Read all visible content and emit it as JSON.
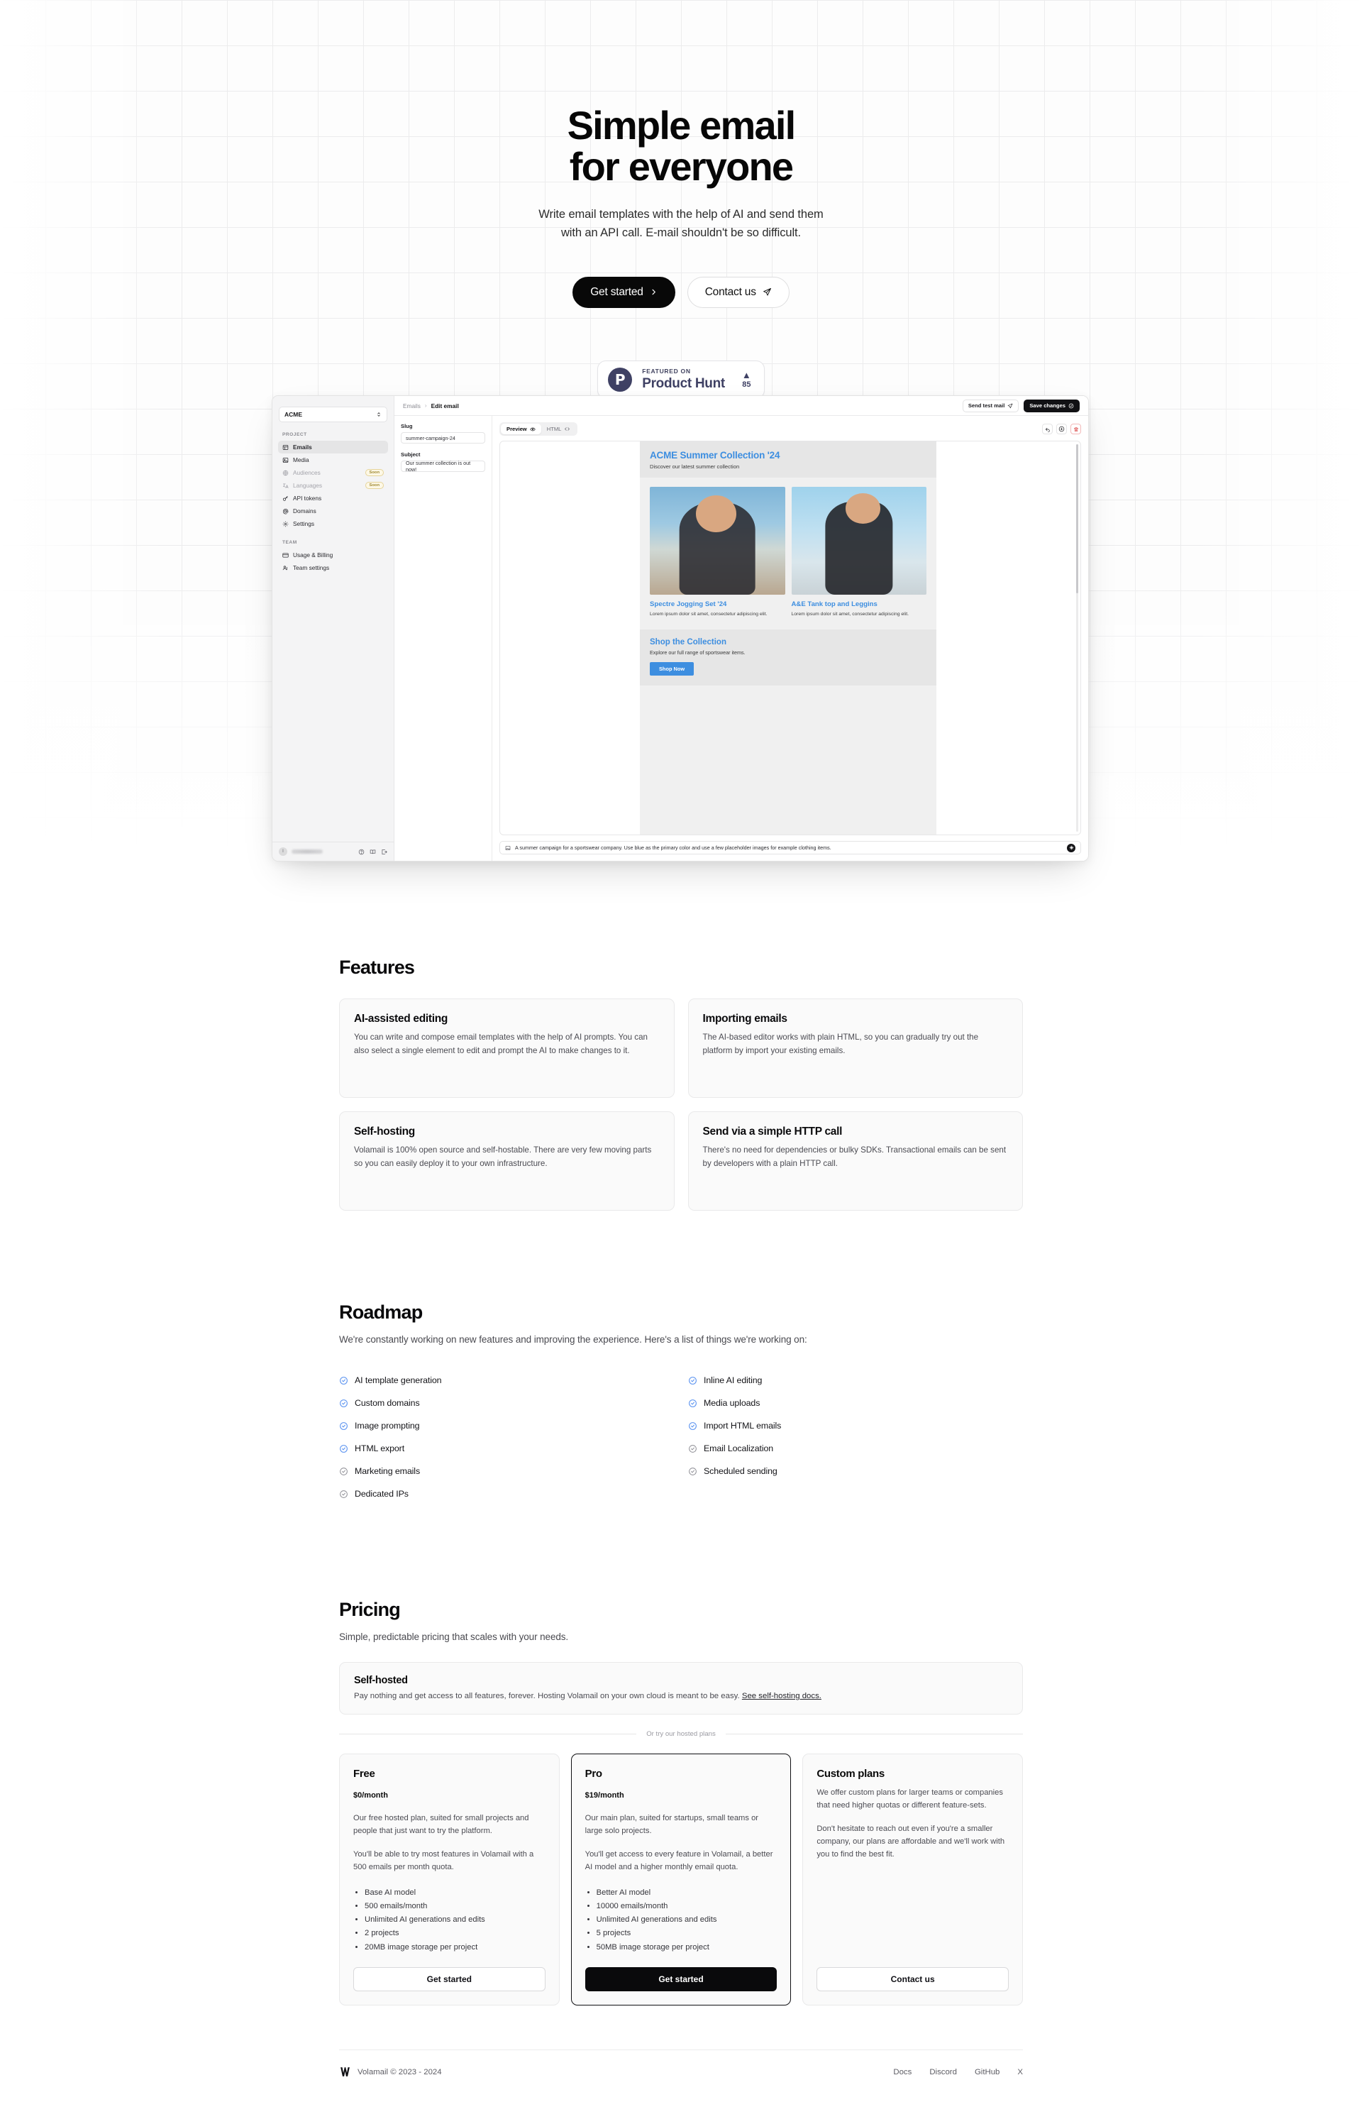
{
  "hero": {
    "title_line1": "Simple email",
    "title_line2": "for everyone",
    "subtitle_line1": "Write email templates with the help of AI and send them",
    "subtitle_line2": "with an API call. E-mail shouldn't be so difficult.",
    "cta_primary": "Get started",
    "cta_primary_icon": "chevron-right-icon",
    "cta_secondary": "Contact us",
    "cta_secondary_icon": "paper-plane-icon"
  },
  "product_hunt": {
    "logo_letter": "P",
    "kicker": "FEATURED ON",
    "name": "Product Hunt",
    "upvote_icon": "▲",
    "votes": "85"
  },
  "app": {
    "project_switcher": "ACME",
    "project_switcher_icon": "chevron-updown-icon",
    "groups": [
      {
        "label": "PROJECT",
        "items": [
          {
            "label": "Emails",
            "icon": "table-icon",
            "active": true,
            "badge": ""
          },
          {
            "label": "Media",
            "icon": "image-icon",
            "active": false,
            "badge": ""
          },
          {
            "label": "Audiences",
            "icon": "globe-icon",
            "active": false,
            "badge": "Soon"
          },
          {
            "label": "Languages",
            "icon": "translate-icon",
            "active": false,
            "badge": "Soon"
          },
          {
            "label": "API tokens",
            "icon": "key-icon",
            "active": false,
            "badge": ""
          },
          {
            "label": "Domains",
            "icon": "at-icon",
            "active": false,
            "badge": ""
          },
          {
            "label": "Settings",
            "icon": "gear-icon",
            "active": false,
            "badge": ""
          }
        ]
      },
      {
        "label": "TEAM",
        "items": [
          {
            "label": "Usage & Billing",
            "icon": "card-icon",
            "active": false,
            "badge": ""
          },
          {
            "label": "Team settings",
            "icon": "users-icon",
            "active": false,
            "badge": ""
          }
        ]
      }
    ],
    "sidebar_footer": {
      "avatar_letter": "I",
      "icons": [
        "help-icon",
        "docs-icon",
        "logout-icon"
      ]
    },
    "breadcrumb_root": "Emails",
    "breadcrumb_sep": "›",
    "breadcrumb_current": "Edit email",
    "send_test_label": "Send test mail",
    "send_test_icon": "paper-plane-icon",
    "save_label": "Save changes",
    "save_icon": "check-circle-icon",
    "slug_label": "Slug",
    "slug_value": "summer-campaign-24",
    "subject_label": "Subject",
    "subject_value": "Our summer collection is out now!",
    "tab_preview": "Preview",
    "tab_preview_icon": "eye-icon",
    "tab_html": "HTML",
    "tab_html_icon": "code-icon",
    "tool_undo_icon": "undo-icon",
    "tool_save_icon": "cloud-save-icon",
    "tool_delete_icon": "trash-icon",
    "prompt_icon": "image-icon",
    "prompt_text": "A summer campaign for a sportswear company. Use blue as the primary color and use a few placeholder images for example clothing items.",
    "prompt_send_icon": "sparkle-icon",
    "email": {
      "heading": "ACME Summer Collection '24",
      "subheading": "Discover our latest summer collection",
      "products": [
        {
          "title": "Spectre Jogging Set '24",
          "desc": "Lorem ipsum dolor sit amet, consectetur adipiscing elit."
        },
        {
          "title": "A&E Tank top and Leggins",
          "desc": "Lorem ipsum dolor sit amet, consectetur adipiscing elit."
        }
      ],
      "footer_title": "Shop the Collection",
      "footer_sub": "Explore our full range of sportswear items.",
      "footer_button": "Shop Now"
    }
  },
  "features": {
    "title": "Features",
    "cards": [
      {
        "title": "AI-assisted editing",
        "body": "You can write and compose email templates with the help of AI prompts. You can also select a single element to edit and prompt the AI to make changes to it."
      },
      {
        "title": "Importing emails",
        "body": "The AI-based editor works with plain HTML, so you can gradually try out the platform by import your existing emails."
      },
      {
        "title": "Self-hosting",
        "body": "Volamail is 100% open source and self-hostable. There are very few moving parts so you can easily deploy it to your own infrastructure."
      },
      {
        "title": "Send via a simple HTTP call",
        "body": "There's no need for dependencies or bulky SDKs. Transactional emails can be sent by developers with a plain HTTP call."
      }
    ]
  },
  "roadmap": {
    "title": "Roadmap",
    "subtitle": "We're constantly working on new features and improving the experience. Here's a list of things we're working on:",
    "done_color": "#5b93f0",
    "pending_color": "#8d8d94",
    "left_items": [
      {
        "label": "AI template generation",
        "done": true
      },
      {
        "label": "Custom domains",
        "done": true
      },
      {
        "label": "Image prompting",
        "done": true
      },
      {
        "label": "HTML export",
        "done": true
      },
      {
        "label": "Marketing emails",
        "done": false
      },
      {
        "label": "Dedicated IPs",
        "done": false
      }
    ],
    "right_items": [
      {
        "label": "Inline AI editing",
        "done": true
      },
      {
        "label": "Media uploads",
        "done": true
      },
      {
        "label": "Import HTML emails",
        "done": true
      },
      {
        "label": "Email Localization",
        "done": false
      },
      {
        "label": "Scheduled sending",
        "done": false
      }
    ]
  },
  "pricing": {
    "title": "Pricing",
    "subtitle": "Simple, predictable pricing that scales with your needs.",
    "self_hosted": {
      "title": "Self-hosted",
      "body": "Pay nothing and get access to all features, forever. Hosting Volamail on your own cloud is meant to be easy. ",
      "link": "See self-hosting docs."
    },
    "divider": "Or try our hosted plans",
    "plans": [
      {
        "name": "Free",
        "price": "$0",
        "period": "/month",
        "p1": "Our free hosted plan, suited for small projects and people that just want to try the platform.",
        "p2": "You'll be able to try most features in Volamail with a 500 emails per month quota.",
        "features": [
          "Base AI model",
          "500 emails/month",
          "Unlimited AI generations and edits",
          "2 projects",
          "20MB image storage per project"
        ],
        "cta": "Get started",
        "featured": false
      },
      {
        "name": "Pro",
        "price": "$19",
        "period": "/month",
        "p1": "Our main plan, suited for startups, small teams or large solo projects.",
        "p2": "You'll get access to every feature in Volamail, a better AI model and a higher monthly email quota.",
        "features": [
          "Better AI model",
          "10000 emails/month",
          "Unlimited AI generations and edits",
          "5 projects",
          "50MB image storage per project"
        ],
        "cta": "Get started",
        "featured": true
      },
      {
        "name": "Custom plans",
        "price": "",
        "period": "",
        "p1": "We offer custom plans for larger teams or companies that need higher quotas or different feature-sets.",
        "p2": "Don't hesitate to reach out even if you're a smaller company, our plans are affordable and we'll work with you to find the best fit.",
        "features": [],
        "cta": "Contact us",
        "featured": false
      }
    ]
  },
  "footer": {
    "logo_icon": "volamail-logo-icon",
    "copyright": "Volamail © 2023 - 2024",
    "links": [
      "Docs",
      "Discord",
      "GitHub",
      "X"
    ]
  }
}
